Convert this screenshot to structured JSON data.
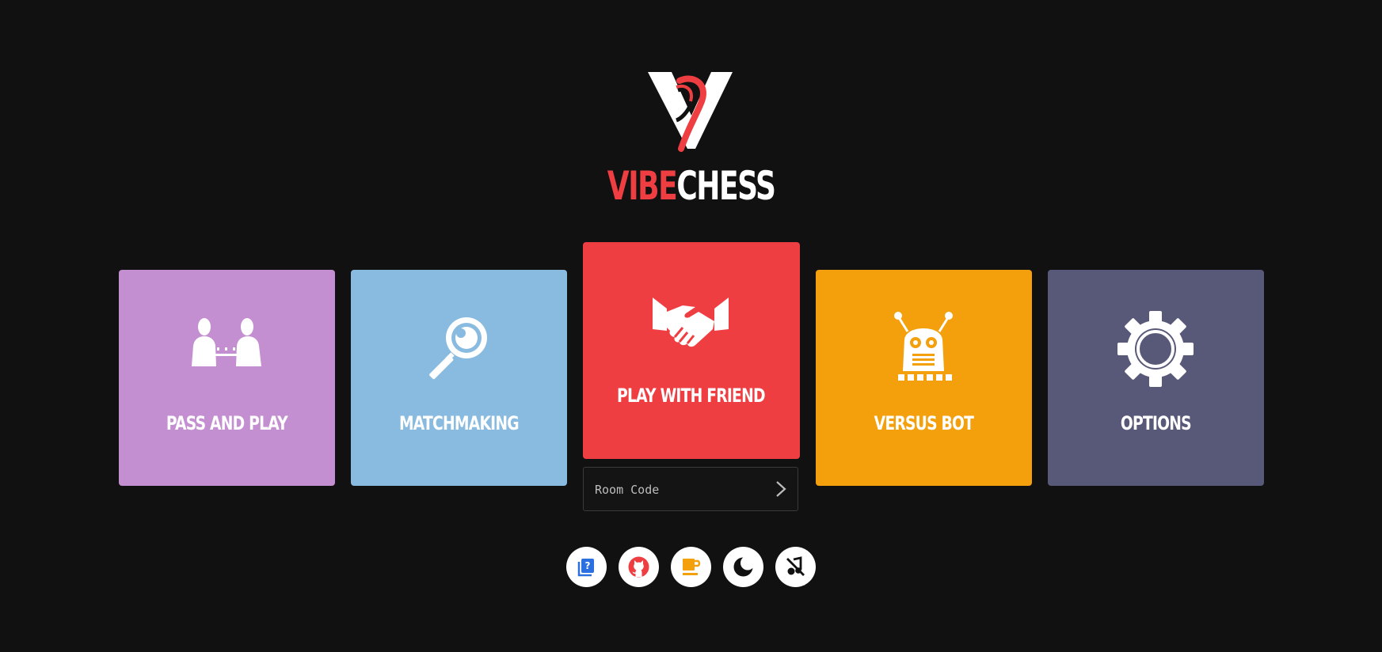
{
  "brand": {
    "word_part1": "VIBE",
    "word_part2": "CHESS",
    "accent_color": "#ef3e42",
    "logo_icon": "vibechess-logo-icon"
  },
  "tiles": [
    {
      "label": "PASS AND PLAY",
      "icon": "pass-and-play-icon",
      "color": "#c38fd1"
    },
    {
      "label": "MATCHMAKING",
      "icon": "magnifier-icon",
      "color": "#88bbdf"
    },
    {
      "label": "PLAY WITH FRIEND",
      "icon": "handshake-icon",
      "color": "#ef3e42"
    },
    {
      "label": "VERSUS BOT",
      "icon": "robot-icon",
      "color": "#f4a00c"
    },
    {
      "label": "OPTIONS",
      "icon": "gear-icon",
      "color": "#585879"
    }
  ],
  "room_code": {
    "placeholder": "Room Code",
    "value": "",
    "submit_icon": "chevron-right-icon"
  },
  "footer_buttons": [
    {
      "icon": "help-book-icon",
      "color": "#2b6fe0"
    },
    {
      "icon": "github-icon",
      "color": "#ef3e42"
    },
    {
      "icon": "coffee-cup-icon",
      "color": "#f4a00c"
    },
    {
      "icon": "dark-mode-moon-icon",
      "color": "#111111"
    },
    {
      "icon": "sound-off-icon",
      "color": "#111111"
    }
  ]
}
